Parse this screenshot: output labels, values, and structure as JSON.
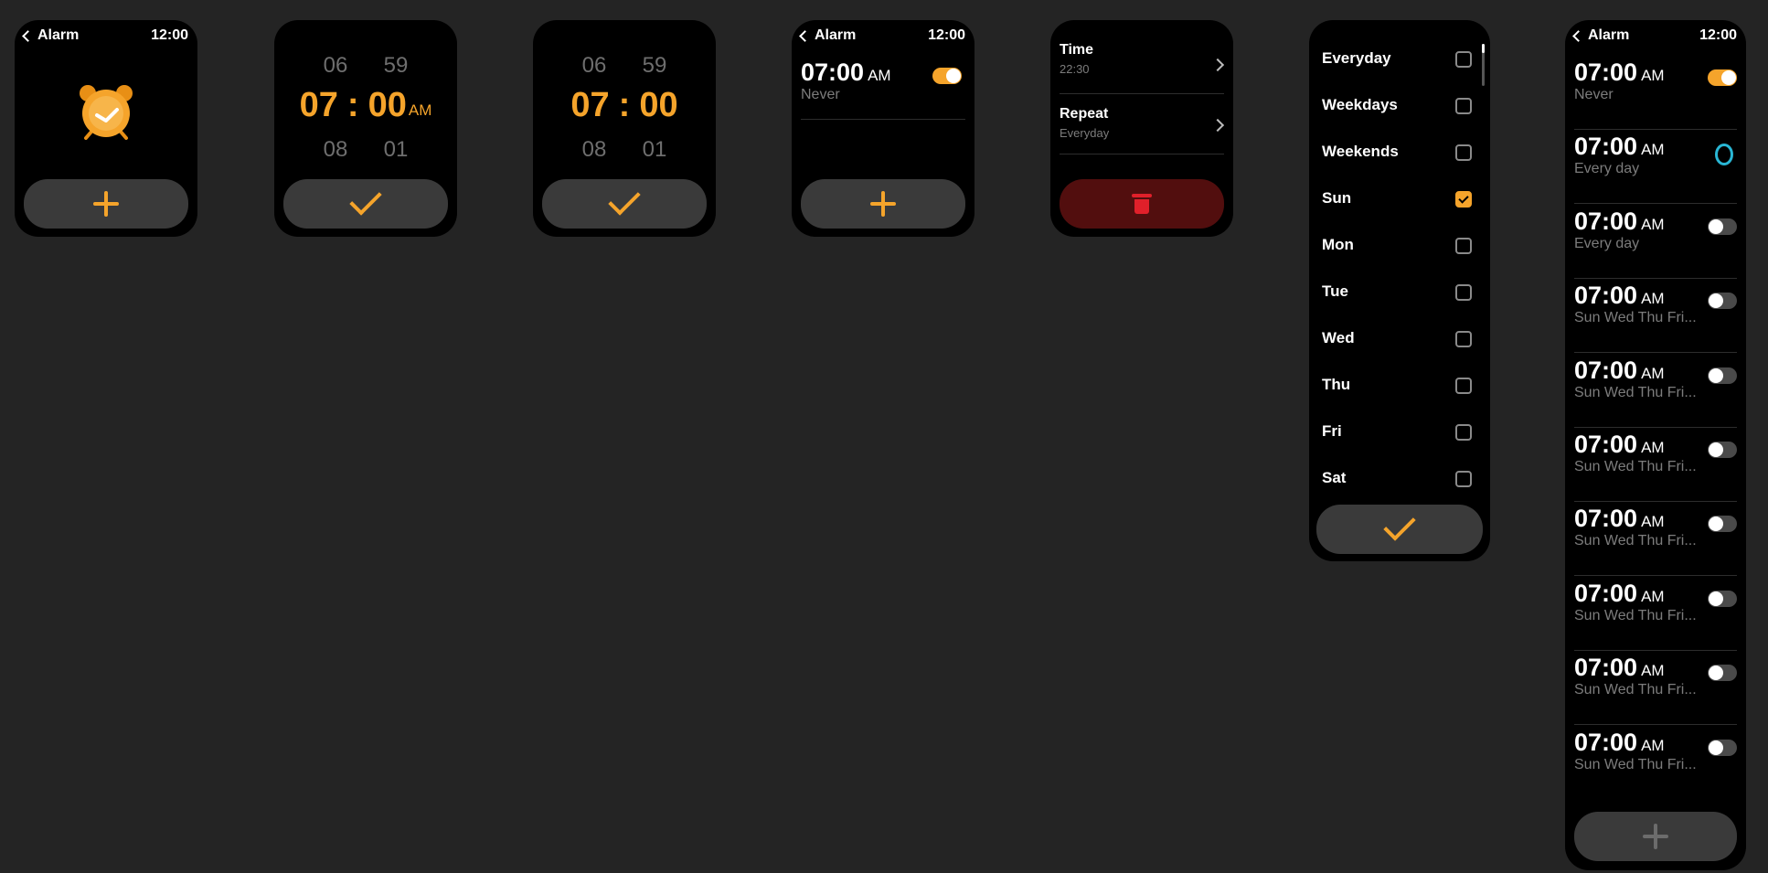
{
  "colors": {
    "accent": "#f5a42b",
    "background": "#242424",
    "danger": "#e0202a",
    "loop_icon": "#29b6d4"
  },
  "screen1": {
    "header": {
      "back_label": "Alarm",
      "clock": "12:00"
    },
    "alarm_icon": "alarm-clock-icon",
    "add_icon": "plus-icon"
  },
  "screen2": {
    "picker": {
      "hour_above": "06",
      "minute_above": "59",
      "hour": "07",
      "separator": ":",
      "minute": "00",
      "ampm": "AM",
      "hour_below": "08",
      "minute_below": "01"
    },
    "confirm_icon": "check-icon"
  },
  "screen3": {
    "picker": {
      "hour_above": "06",
      "minute_above": "59",
      "hour": "07",
      "separator": ":",
      "minute": "00",
      "hour_below": "08",
      "minute_below": "01"
    },
    "confirm_icon": "check-icon"
  },
  "screen4": {
    "header": {
      "back_label": "Alarm",
      "clock": "12:00"
    },
    "alarm": {
      "time": "07:00",
      "ampm": "AM",
      "repeat": "Never",
      "enabled": true
    },
    "add_icon": "plus-icon"
  },
  "screen5": {
    "rows": [
      {
        "label": "Time",
        "value": "22:30"
      },
      {
        "label": "Repeat",
        "value": "Everyday"
      }
    ],
    "delete_icon": "trash-icon"
  },
  "screen6": {
    "options": [
      {
        "label": "Everyday",
        "checked": false
      },
      {
        "label": "Weekdays",
        "checked": false
      },
      {
        "label": "Weekends",
        "checked": false
      },
      {
        "label": "Sun",
        "checked": true
      },
      {
        "label": "Mon",
        "checked": false
      },
      {
        "label": "Tue",
        "checked": false
      },
      {
        "label": "Wed",
        "checked": false
      },
      {
        "label": "Thu",
        "checked": false
      },
      {
        "label": "Fri",
        "checked": false
      },
      {
        "label": "Sat",
        "checked": false
      }
    ],
    "confirm_icon": "check-icon"
  },
  "screen7": {
    "header": {
      "back_label": "Alarm",
      "clock": "12:00"
    },
    "alarms": [
      {
        "time": "07:00",
        "ampm": "AM",
        "repeat": "Never",
        "state": "on"
      },
      {
        "time": "07:00",
        "ampm": "AM",
        "repeat": "Every day",
        "state": "loading"
      },
      {
        "time": "07:00",
        "ampm": "AM",
        "repeat": "Every day",
        "state": "off"
      },
      {
        "time": "07:00",
        "ampm": "AM",
        "repeat": "Sun Wed Thu Fri...",
        "state": "off"
      },
      {
        "time": "07:00",
        "ampm": "AM",
        "repeat": "Sun Wed Thu Fri...",
        "state": "off"
      },
      {
        "time": "07:00",
        "ampm": "AM",
        "repeat": "Sun Wed Thu Fri...",
        "state": "off"
      },
      {
        "time": "07:00",
        "ampm": "AM",
        "repeat": "Sun Wed Thu Fri...",
        "state": "off"
      },
      {
        "time": "07:00",
        "ampm": "AM",
        "repeat": "Sun Wed Thu Fri...",
        "state": "off"
      },
      {
        "time": "07:00",
        "ampm": "AM",
        "repeat": "Sun Wed Thu Fri...",
        "state": "off"
      },
      {
        "time": "07:00",
        "ampm": "AM",
        "repeat": "Sun Wed Thu Fri...",
        "state": "off"
      }
    ],
    "add_icon": "plus-icon"
  }
}
